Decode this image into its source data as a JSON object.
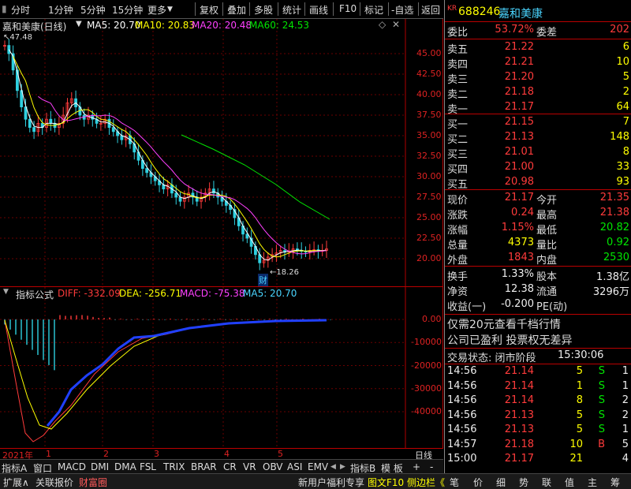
{
  "toolbar": {
    "left": [
      "分时",
      "1分钟",
      "5分钟",
      "15分钟",
      "更多"
    ],
    "right": [
      "复权",
      "叠加",
      "多股",
      "统计",
      "画线",
      "F10",
      "标记",
      "-自选",
      "返回"
    ]
  },
  "main_legend": {
    "name": "嘉和美康(日线)",
    "ma5": "MA5: 20.70",
    "ma10": "MA10: 20.83",
    "ma20": "MA20: 20.48",
    "ma60": "MA60: 24.53",
    "high_label": "47.48",
    "low_label": "18.26",
    "event_label": "财"
  },
  "main_yticks": [
    "45.00",
    "42.50",
    "40.00",
    "37.50",
    "35.00",
    "32.50",
    "30.00",
    "27.50",
    "25.00",
    "22.50",
    "20.00"
  ],
  "ind_legend": {
    "name": "指标公式",
    "diff": "DIFF: -332.09",
    "dea": "DEA: -256.71",
    "macd": "MACD: -75.38",
    "ma5": "MA5: 20.70"
  },
  "ind_yticks": [
    "0.00",
    "-10000",
    "-20000",
    "-30000",
    "-40000"
  ],
  "time_axis": {
    "labels": [
      "2021年",
      "1",
      "2",
      "3",
      "4",
      "5"
    ],
    "right": "日线"
  },
  "tabs": [
    "指标A",
    "窗口",
    "MACD",
    "DMI",
    "DMA",
    "FSL",
    "TRIX",
    "BRAR",
    "CR",
    "VR",
    "OBV",
    "ASI",
    "EMV"
  ],
  "tabs_right": [
    "指标B",
    "模",
    "板",
    "+",
    "-"
  ],
  "status": {
    "left": [
      "扩展",
      "关联报价",
      "财富圈"
    ],
    "mid": [
      "新用户福利专享",
      "图文F10",
      "侧边栏"
    ],
    "right": [
      "笔",
      "价",
      "细",
      "势",
      "联",
      "值",
      "主",
      "筹"
    ]
  },
  "stock": {
    "badge": "KR",
    "code": "688246",
    "name": "嘉和美康"
  },
  "weibi": {
    "label1": "委比",
    "val1": "53.72%",
    "label2": "委差",
    "val2": "202"
  },
  "sell": [
    {
      "label": "卖五",
      "price": "21.22",
      "vol": "6"
    },
    {
      "label": "卖四",
      "price": "21.21",
      "vol": "10"
    },
    {
      "label": "卖三",
      "price": "21.20",
      "vol": "5"
    },
    {
      "label": "卖二",
      "price": "21.18",
      "vol": "2"
    },
    {
      "label": "卖一",
      "price": "21.17",
      "vol": "64"
    }
  ],
  "buy": [
    {
      "label": "买一",
      "price": "21.15",
      "vol": "7"
    },
    {
      "label": "买二",
      "price": "21.13",
      "vol": "148"
    },
    {
      "label": "买三",
      "price": "21.01",
      "vol": "8"
    },
    {
      "label": "买四",
      "price": "21.00",
      "vol": "33"
    },
    {
      "label": "买五",
      "price": "20.98",
      "vol": "93"
    }
  ],
  "quote": [
    {
      "l1": "现价",
      "v1": "21.17",
      "c1": "red",
      "l2": "今开",
      "v2": "21.35",
      "c2": "red"
    },
    {
      "l1": "涨跌",
      "v1": "0.24",
      "c1": "red",
      "l2": "最高",
      "v2": "21.38",
      "c2": "red"
    },
    {
      "l1": "涨幅",
      "v1": "1.15%",
      "c1": "red",
      "l2": "最低",
      "v2": "20.82",
      "c2": "grn"
    },
    {
      "l1": "总量",
      "v1": "4373",
      "c1": "yel",
      "l2": "量比",
      "v2": "0.92",
      "c2": "grn"
    },
    {
      "l1": "外盘",
      "v1": "1843",
      "c1": "red",
      "l2": "内盘",
      "v2": "2530",
      "c2": "grn"
    }
  ],
  "fund": [
    {
      "l1": "换手",
      "v1": "1.33%",
      "l2": "股本",
      "v2": "1.38亿"
    },
    {
      "l1": "净资",
      "v1": "12.38",
      "l2": "流通",
      "v2": "3296万"
    },
    {
      "l1": "收益(一)",
      "v1": "-0.200",
      "l2": "PE(动)",
      "v2": ""
    }
  ],
  "promo1": "仅需20元查看千档行情",
  "promo2": "公司已盈利 投票权无差异",
  "trade_status": {
    "label": "交易状态: 闭市阶段",
    "time": "15:30:06"
  },
  "ticks": [
    {
      "time": "14:56",
      "price": "21.14",
      "vol": "5",
      "side": "S",
      "n": "1"
    },
    {
      "time": "14:56",
      "price": "21.14",
      "vol": "1",
      "side": "S",
      "n": "1"
    },
    {
      "time": "14:56",
      "price": "21.14",
      "vol": "8",
      "side": "S",
      "n": "2"
    },
    {
      "time": "14:56",
      "price": "21.13",
      "vol": "5",
      "side": "S",
      "n": "2"
    },
    {
      "time": "14:56",
      "price": "21.13",
      "vol": "5",
      "side": "S",
      "n": "1"
    },
    {
      "time": "14:57",
      "price": "21.18",
      "vol": "10",
      "side": "B",
      "n": "5"
    },
    {
      "time": "15:00",
      "price": "21.17",
      "vol": "21",
      "side": "",
      "n": "4"
    }
  ],
  "colors": {
    "up": "#ff3b3b",
    "down": "#00e600",
    "grid": "#b00000",
    "ma5": "#ffffff",
    "ma10": "#ffff00",
    "ma20": "#ff40ff",
    "ma60": "#00e600"
  }
}
